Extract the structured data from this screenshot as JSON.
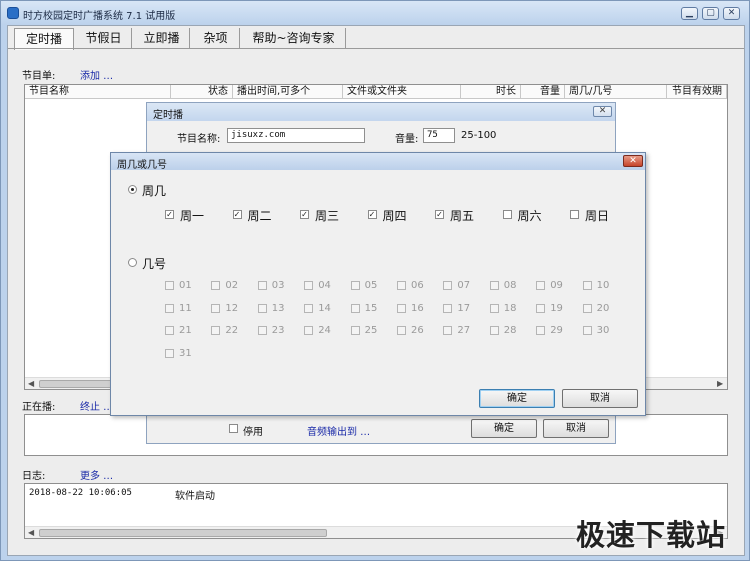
{
  "window": {
    "title": "时方校园定时广播系统 7.1 试用版"
  },
  "tabs": [
    "定时播",
    "节假日",
    "立即播",
    "杂项",
    "帮助~咨询专家"
  ],
  "program": {
    "label": "节目单:",
    "add_link": "添加 …",
    "columns": [
      "节目名称",
      "状态",
      "播出时间,可多个",
      "文件或文件夹",
      "时长",
      "音量",
      "周几/几号",
      "节目有效期"
    ]
  },
  "playing": {
    "label": "正在播:",
    "stop_link": "终止 …"
  },
  "log": {
    "label": "日志:",
    "more_link": "更多 …",
    "entries": [
      {
        "time": "2018-08-22 10:06:05",
        "message": "软件启动"
      }
    ]
  },
  "timed_dialog": {
    "title": "定时播",
    "name_label": "节目名称:",
    "name_value": "jisuxz.com",
    "volume_label": "音量:",
    "volume_value": "75",
    "volume_range": "25-100",
    "disable_label": "停用",
    "audio_output_link": "音频输出到 …",
    "ok_label": "确定",
    "cancel_label": "取消"
  },
  "weekday_dialog": {
    "title": "周几或几号",
    "weekday_option": "周几",
    "weekday_selected": true,
    "days": [
      {
        "label": "周一",
        "checked": true
      },
      {
        "label": "周二",
        "checked": true
      },
      {
        "label": "周三",
        "checked": true
      },
      {
        "label": "周四",
        "checked": true
      },
      {
        "label": "周五",
        "checked": true
      },
      {
        "label": "周六",
        "checked": false
      },
      {
        "label": "周日",
        "checked": false
      }
    ],
    "date_option": "几号",
    "dates": [
      "01",
      "02",
      "03",
      "04",
      "05",
      "06",
      "07",
      "08",
      "09",
      "10",
      "11",
      "12",
      "13",
      "14",
      "15",
      "16",
      "17",
      "18",
      "19",
      "20",
      "21",
      "22",
      "23",
      "24",
      "25",
      "26",
      "27",
      "28",
      "29",
      "30",
      "31"
    ],
    "ok_label": "确定",
    "cancel_label": "取消"
  },
  "watermark": "极速下载站",
  "colors": {
    "title_bar": "#bcd2ec",
    "link": "#1a2aa8",
    "close_red": "#c6452b"
  }
}
